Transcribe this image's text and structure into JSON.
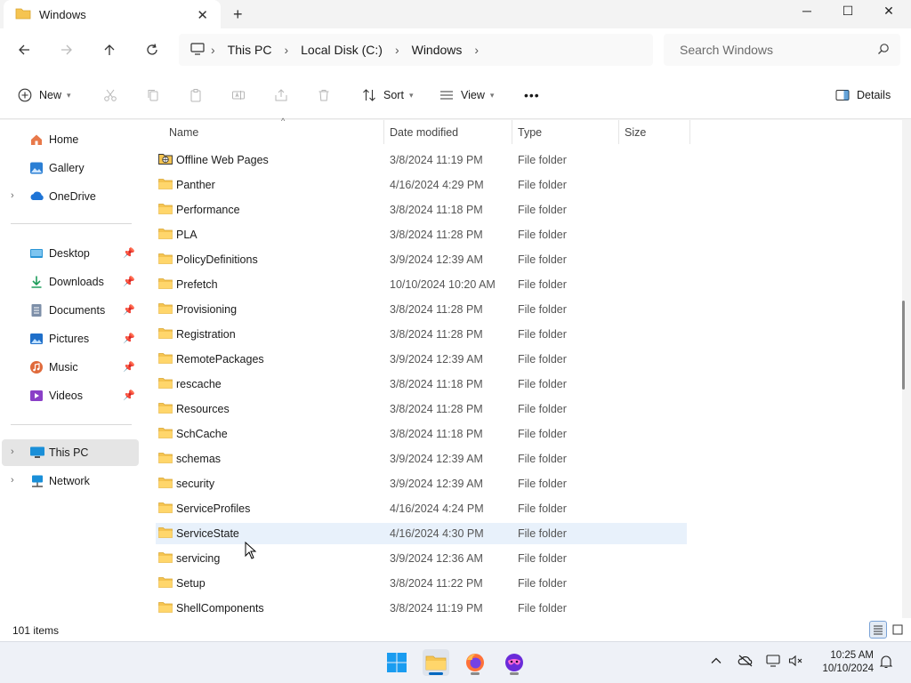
{
  "window": {
    "tab_title": "Windows",
    "tab_close": "✕",
    "new_tab": "+",
    "minimize": "─",
    "maximize": "☐",
    "close": "✕"
  },
  "address_bar": {
    "breadcrumbs": [
      "This PC",
      "Local Disk (C:)",
      "Windows"
    ],
    "search_placeholder": "Search Windows"
  },
  "toolbar": {
    "new_label": "New",
    "sort_label": "Sort",
    "view_label": "View",
    "more_label": "•••",
    "details_label": "Details"
  },
  "sidebar": {
    "items": [
      {
        "label": "Home",
        "icon": "home-icon"
      },
      {
        "label": "Gallery",
        "icon": "gallery-icon"
      },
      {
        "label": "OneDrive",
        "icon": "cloud-icon"
      },
      {
        "label": "Desktop",
        "icon": "desktop-icon"
      },
      {
        "label": "Downloads",
        "icon": "download-icon"
      },
      {
        "label": "Documents",
        "icon": "document-icon"
      },
      {
        "label": "Pictures",
        "icon": "picture-icon"
      },
      {
        "label": "Music",
        "icon": "music-icon"
      },
      {
        "label": "Videos",
        "icon": "video-icon"
      },
      {
        "label": "This PC",
        "icon": "computer-icon"
      },
      {
        "label": "Network",
        "icon": "network-icon"
      }
    ]
  },
  "file_list": {
    "columns": [
      "Name",
      "Date modified",
      "Type",
      "Size"
    ],
    "rows": [
      {
        "name": "Offline Web Pages",
        "date": "3/8/2024 11:19 PM",
        "type": "File folder"
      },
      {
        "name": "Panther",
        "date": "4/16/2024 4:29 PM",
        "type": "File folder"
      },
      {
        "name": "Performance",
        "date": "3/8/2024 11:18 PM",
        "type": "File folder"
      },
      {
        "name": "PLA",
        "date": "3/8/2024 11:28 PM",
        "type": "File folder"
      },
      {
        "name": "PolicyDefinitions",
        "date": "3/9/2024 12:39 AM",
        "type": "File folder"
      },
      {
        "name": "Prefetch",
        "date": "10/10/2024 10:20 AM",
        "type": "File folder"
      },
      {
        "name": "Provisioning",
        "date": "3/8/2024 11:28 PM",
        "type": "File folder"
      },
      {
        "name": "Registration",
        "date": "3/8/2024 11:28 PM",
        "type": "File folder"
      },
      {
        "name": "RemotePackages",
        "date": "3/9/2024 12:39 AM",
        "type": "File folder"
      },
      {
        "name": "rescache",
        "date": "3/8/2024 11:18 PM",
        "type": "File folder"
      },
      {
        "name": "Resources",
        "date": "3/8/2024 11:28 PM",
        "type": "File folder"
      },
      {
        "name": "SchCache",
        "date": "3/8/2024 11:18 PM",
        "type": "File folder"
      },
      {
        "name": "schemas",
        "date": "3/9/2024 12:39 AM",
        "type": "File folder"
      },
      {
        "name": "security",
        "date": "3/9/2024 12:39 AM",
        "type": "File folder"
      },
      {
        "name": "ServiceProfiles",
        "date": "4/16/2024 4:24 PM",
        "type": "File folder"
      },
      {
        "name": "ServiceState",
        "date": "4/16/2024 4:30 PM",
        "type": "File folder"
      },
      {
        "name": "servicing",
        "date": "3/9/2024 12:36 AM",
        "type": "File folder"
      },
      {
        "name": "Setup",
        "date": "3/8/2024 11:22 PM",
        "type": "File folder"
      },
      {
        "name": "ShellComponents",
        "date": "3/8/2024 11:19 PM",
        "type": "File folder"
      }
    ]
  },
  "status_bar": {
    "item_count": "101 items"
  },
  "taskbar": {
    "time": "10:25 AM",
    "date": "10/10/2024"
  },
  "colors": {
    "accent": "#0067c0",
    "folder_yellow": "#f5c451",
    "hover_row": "#e8f1fb"
  }
}
